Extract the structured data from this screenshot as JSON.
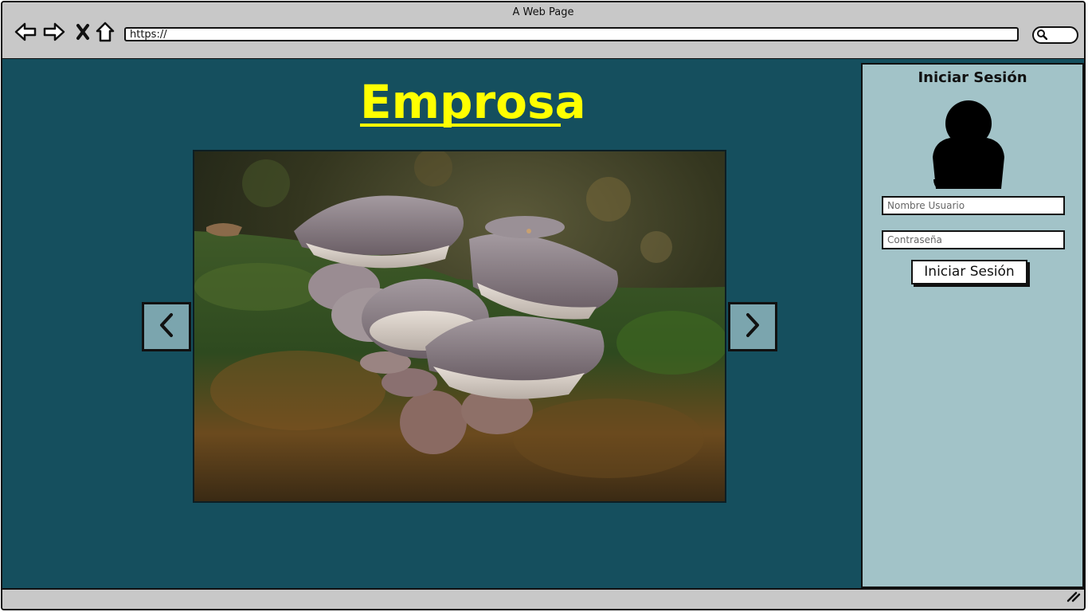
{
  "window": {
    "title": "A Web Page"
  },
  "browser": {
    "url": "https://",
    "nav": {
      "back": "back-arrow-icon",
      "forward": "forward-arrow-icon",
      "stop": "close-icon",
      "home": "home-icon"
    },
    "search_icon": "search-icon"
  },
  "page": {
    "title": "Emprosa",
    "title_color": "#ffff00",
    "background": "#154f5e",
    "carousel": {
      "image_description_icon": "mushroom-photo",
      "prev_icon": "chevron-left-icon",
      "next_icon": "chevron-right-icon"
    }
  },
  "login": {
    "title": "Iniciar Sesión",
    "avatar_icon": "user-avatar-icon",
    "username_placeholder": "Nombre Usuario",
    "password_placeholder": "Contraseña",
    "submit_label": "Iniciar Sesión"
  }
}
